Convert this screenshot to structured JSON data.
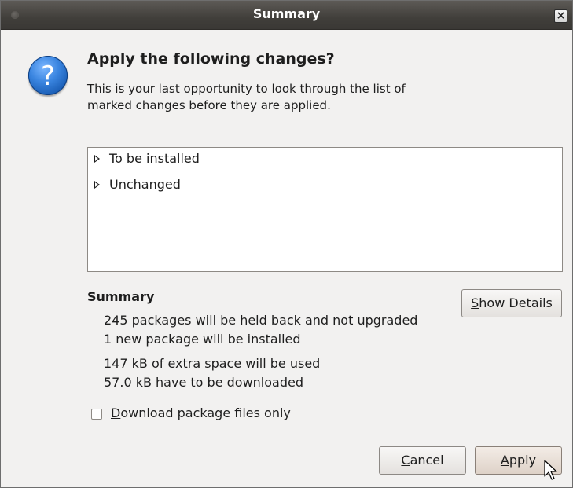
{
  "window": {
    "title": "Summary",
    "close_glyph": "×"
  },
  "header": {
    "icon": "question-icon",
    "heading": "Apply the following changes?",
    "description": "This is your last opportunity to look through the list of marked changes before they are applied."
  },
  "changes_list": {
    "items": [
      {
        "label": "To be installed",
        "expanded": false
      },
      {
        "label": "Unchanged",
        "expanded": false
      }
    ]
  },
  "summary": {
    "title": "Summary",
    "lines": [
      "245 packages will be held back and not upgraded",
      "1 new package will be installed",
      "147 kB of extra space will be used",
      "57.0 kB have to be downloaded"
    ],
    "show_details": {
      "mnemonic": "S",
      "rest": "how Details"
    }
  },
  "download_only": {
    "checked": false,
    "mnemonic": "D",
    "rest": "ownload package files only"
  },
  "buttons": {
    "cancel": {
      "mnemonic": "C",
      "rest": "ancel"
    },
    "apply": {
      "mnemonic": "A",
      "rest": "pply"
    }
  },
  "colors": {
    "titlebar": "#3f3d39",
    "dialog_bg": "#f2f1f0",
    "icon_blue": "#2f7bd8"
  }
}
